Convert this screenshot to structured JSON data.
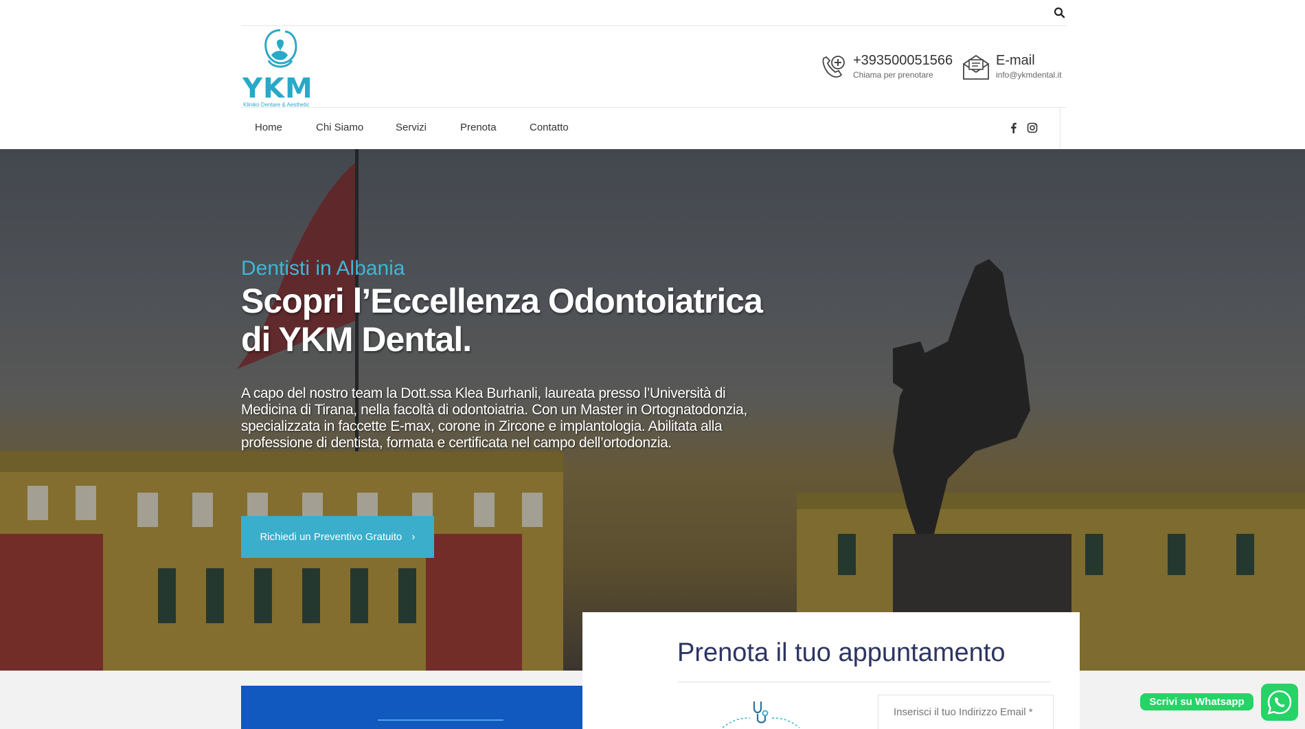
{
  "topbar": {
    "search_icon": "search-icon"
  },
  "logo": {
    "text": "YKM",
    "subtitle": "Kliniko Dentare & Aesthetic",
    "color": "#2aa8c8"
  },
  "contact": {
    "phone": {
      "number": "+393500051566",
      "caption": "Chiama per prenotare",
      "icon": "medical-phone-icon"
    },
    "email": {
      "label": "E-mail",
      "address": "info@ykmdental.it",
      "icon": "envelope-icon"
    }
  },
  "nav": {
    "items": [
      {
        "label": "Home"
      },
      {
        "label": "Chi Siamo"
      },
      {
        "label": "Servizi"
      },
      {
        "label": "Prenota"
      },
      {
        "label": "Contatto"
      }
    ],
    "social": [
      "facebook-icon",
      "instagram-icon"
    ]
  },
  "hero": {
    "eyebrow": "Dentisti in Albania",
    "headline": "Scopri l’Eccellenza Odontoiatrica di YKM Dental.",
    "text": "A capo del nostro team la Dott.ssa Klea Burhanli, laureata presso l’Università di Medicina di Tirana, nella facoltà di odontoiatria. Con un Master in Ortognatodonzia, specializzata in faccette E-max, corone in Zircone e implantologia. Abilitata alla professione di dentista, formata e certificata nel campo dell’ortodonzia.",
    "cta": "Richiedi un Preventivo Gratuito",
    "accent": "#3aaecb"
  },
  "booking": {
    "title": "Prenota il tuo appuntamento",
    "email_placeholder": "Inserisci il tuo Indirizzo Email *",
    "title_color": "#2d3561"
  },
  "whatsapp": {
    "label": "Scrivi su Whatsapp",
    "color": "#25d366"
  }
}
